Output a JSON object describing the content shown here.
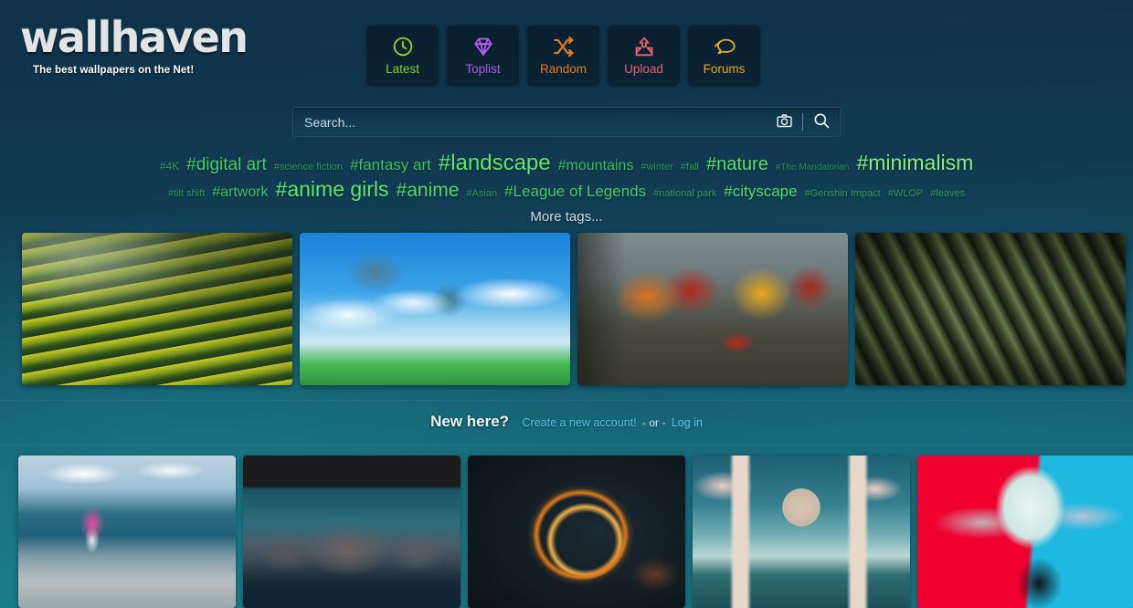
{
  "site": {
    "logo": "wallhaven",
    "tagline": "The best wallpapers on the Net!"
  },
  "nav": {
    "items": [
      {
        "label": "Latest",
        "icon": "clock-icon",
        "color": "#8ccf2a"
      },
      {
        "label": "Toplist",
        "icon": "diamond-icon",
        "color": "#b05ce8"
      },
      {
        "label": "Random",
        "icon": "shuffle-icon",
        "color": "#e87a22"
      },
      {
        "label": "Upload",
        "icon": "upload-icon",
        "color": "#e8646e"
      },
      {
        "label": "Forums",
        "icon": "comments-icon",
        "color": "#e8a82a"
      }
    ]
  },
  "search": {
    "placeholder": "Search...",
    "value": "",
    "camera_icon": "camera-icon",
    "submit_icon": "magnifier-icon"
  },
  "tags": {
    "more_label": "More tags...",
    "rows": [
      [
        {
          "label": "#4K",
          "size": 12,
          "color": "#2f9e5e"
        },
        {
          "label": "#digital art",
          "size": 19,
          "color": "#45cf6a"
        },
        {
          "label": "#science fiction",
          "size": 11,
          "color": "#2c9a58"
        },
        {
          "label": "#fantasy art",
          "size": 17,
          "color": "#3cc264"
        },
        {
          "label": "#landscape",
          "size": 24,
          "color": "#5ce86f"
        },
        {
          "label": "#mountains",
          "size": 16,
          "color": "#3bbf63"
        },
        {
          "label": "#winter",
          "size": 11,
          "color": "#2c9a58"
        },
        {
          "label": "#fall",
          "size": 11,
          "color": "#2f9e5e"
        },
        {
          "label": "#nature",
          "size": 20,
          "color": "#58e06b"
        },
        {
          "label": "#The Mandalorian",
          "size": 10,
          "color": "#2b9255"
        },
        {
          "label": "#minimalism",
          "size": 23,
          "color": "#88ef7c"
        }
      ],
      [
        {
          "label": "#tilt shift",
          "size": 11,
          "color": "#2c9a58"
        },
        {
          "label": "#artwork",
          "size": 16,
          "color": "#3cc264"
        },
        {
          "label": "#anime girls",
          "size": 23,
          "color": "#5ce86f"
        },
        {
          "label": "#anime",
          "size": 21,
          "color": "#4fd96b"
        },
        {
          "label": "#Asian",
          "size": 11,
          "color": "#2c9a58"
        },
        {
          "label": "#League of Legends",
          "size": 17,
          "color": "#46cc68"
        },
        {
          "label": "#national park",
          "size": 11,
          "color": "#2f9e5e"
        },
        {
          "label": "#cityscape",
          "size": 17,
          "color": "#54df6d"
        },
        {
          "label": "#Genshin Impact",
          "size": 11,
          "color": "#2f9e5e"
        },
        {
          "label": "#WLOP",
          "size": 11,
          "color": "#2c9a58"
        },
        {
          "label": "#leaves",
          "size": 11,
          "color": "#2f9e5e"
        }
      ]
    ]
  },
  "featured": {
    "items": [
      {
        "name": "rice-terraces-wallpaper",
        "art": "a-terrace"
      },
      {
        "name": "anime-sky-islands-wallpaper",
        "art": "a-sky"
      },
      {
        "name": "autumn-forest-wallpaper",
        "art": "a-autumn"
      },
      {
        "name": "grass-blades-wallpaper",
        "art": "a-grass"
      }
    ]
  },
  "newhere": {
    "question": "New here?",
    "create_link": "Create a new account!",
    "or": "- or -",
    "login_link": "Log in"
  },
  "latest": {
    "items": [
      {
        "name": "anime-beach-girl-wallpaper",
        "art": "a-beach"
      },
      {
        "name": "night-mountains-wallpaper",
        "art": "a-mountain"
      },
      {
        "name": "scifi-orbital-ring-wallpaper",
        "art": "a-ring"
      },
      {
        "name": "scifi-arch-planet-wallpaper",
        "art": "a-arch"
      },
      {
        "name": "anime-girl-red-cyan-wallpaper",
        "art": "a-anime"
      }
    ]
  }
}
